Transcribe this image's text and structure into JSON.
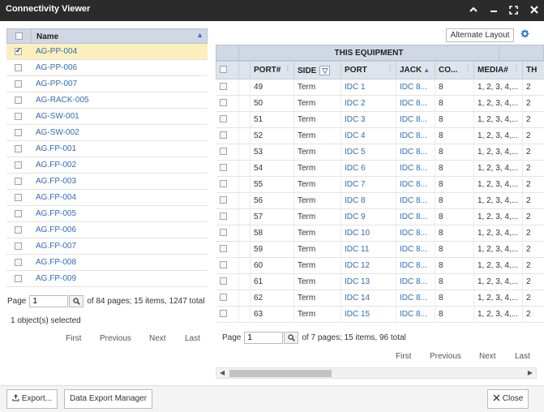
{
  "window": {
    "title": "Connectivity Viewer",
    "controls": [
      "collapse-icon",
      "minimize-icon",
      "maximize-icon",
      "close-icon"
    ]
  },
  "left_list": {
    "header": {
      "name": "Name"
    },
    "items": [
      {
        "name": "AG-PP-004",
        "checked": true,
        "selected": true
      },
      {
        "name": "AG-PP-006"
      },
      {
        "name": "AG-PP-007"
      },
      {
        "name": "AG-RACK-005"
      },
      {
        "name": "AG-SW-001"
      },
      {
        "name": "AG-SW-002"
      },
      {
        "name": "AG.FP-001"
      },
      {
        "name": "AG.FP-002"
      },
      {
        "name": "AG.FP-003"
      },
      {
        "name": "AG.FP-004"
      },
      {
        "name": "AG.FP-005"
      },
      {
        "name": "AG.FP-006"
      },
      {
        "name": "AG.FP-007"
      },
      {
        "name": "AG.FP-008"
      },
      {
        "name": "AG.FP-009"
      }
    ],
    "pager": {
      "label": "Page",
      "value": "1",
      "summary": "of 84 pages; 15 items, 1247 total",
      "selected_text": "1 object(s) selected",
      "first": "First",
      "previous": "Previous",
      "next": "Next",
      "last": "Last"
    }
  },
  "right_grid": {
    "alternate_layout": "Alternate Layout",
    "group_title": "THIS EQUIPMENT",
    "columns": [
      "PORT#",
      "SIDE",
      "PORT",
      "JACK",
      "CO...",
      "MEDIA#",
      "TH"
    ],
    "rows": [
      [
        "49",
        "Term",
        "IDC 1",
        "IDC 8...",
        "8",
        "1, 2, 3, 4,...",
        "2"
      ],
      [
        "50",
        "Term",
        "IDC 2",
        "IDC 8...",
        "8",
        "1, 2, 3, 4,...",
        "2"
      ],
      [
        "51",
        "Term",
        "IDC 3",
        "IDC 8...",
        "8",
        "1, 2, 3, 4,...",
        "2"
      ],
      [
        "52",
        "Term",
        "IDC 4",
        "IDC 8...",
        "8",
        "1, 2, 3, 4,...",
        "2"
      ],
      [
        "53",
        "Term",
        "IDC 5",
        "IDC 8...",
        "8",
        "1, 2, 3, 4,...",
        "2"
      ],
      [
        "54",
        "Term",
        "IDC 6",
        "IDC 8...",
        "8",
        "1, 2, 3, 4,...",
        "2"
      ],
      [
        "55",
        "Term",
        "IDC 7",
        "IDC 8...",
        "8",
        "1, 2, 3, 4,...",
        "2"
      ],
      [
        "56",
        "Term",
        "IDC 8",
        "IDC 8...",
        "8",
        "1, 2, 3, 4,...",
        "2"
      ],
      [
        "57",
        "Term",
        "IDC 9",
        "IDC 8...",
        "8",
        "1, 2, 3, 4,...",
        "2"
      ],
      [
        "58",
        "Term",
        "IDC 10",
        "IDC 8...",
        "8",
        "1, 2, 3, 4,...",
        "2"
      ],
      [
        "59",
        "Term",
        "IDC 11",
        "IDC 8...",
        "8",
        "1, 2, 3, 4,...",
        "2"
      ],
      [
        "60",
        "Term",
        "IDC 12",
        "IDC 8...",
        "8",
        "1, 2, 3, 4,...",
        "2"
      ],
      [
        "61",
        "Term",
        "IDC 13",
        "IDC 8...",
        "8",
        "1, 2, 3, 4,...",
        "2"
      ],
      [
        "62",
        "Term",
        "IDC 14",
        "IDC 8...",
        "8",
        "1, 2, 3, 4,...",
        "2"
      ],
      [
        "63",
        "Term",
        "IDC 15",
        "IDC 8...",
        "8",
        "1, 2, 3, 4,...",
        "2"
      ]
    ],
    "pager": {
      "label": "Page",
      "value": "1",
      "summary": "of 7 pages; 15 items, 96 total",
      "first": "First",
      "previous": "Previous",
      "next": "Next",
      "last": "Last"
    }
  },
  "footer": {
    "export": "Export...",
    "data_export_manager": "Data Export Manager",
    "close": "Close"
  },
  "colors": {
    "titlebar": "#2b2b2b",
    "header": "#cfd8e3",
    "selected_row": "#fbf0bd",
    "link": "#2f6db5"
  }
}
